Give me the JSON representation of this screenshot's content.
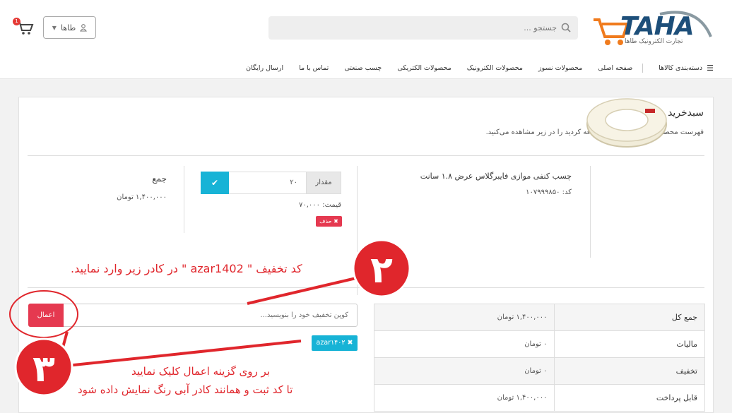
{
  "header": {
    "logo_text": "TAHA",
    "logo_subtitle": "تجارت الکترونیک طاها",
    "search_placeholder": "جستجو ...",
    "user_label": "طاها",
    "cart_count": "1"
  },
  "nav": {
    "categories_label": "دسته‌بندی کالاها",
    "items": [
      "صفحه اصلی",
      "محصولات نسوز",
      "محصولات الکترونیک",
      "محصولات الکتریکی",
      "چسب صنعتی",
      "تماس با ما",
      "ارسال رایگان"
    ]
  },
  "cart": {
    "title": "سبدخرید",
    "subtitle": "فهرست محصولاتی که به سبدخرید اضافه کردید را در زیر مشاهده می‌کنید.",
    "product": {
      "name": "چسب کنفی موازی فایبرگلاس عرض ۱.۸ سانت",
      "code": "کد: ۱۰۷۹۹۹۸۵۰",
      "qty_label": "مقدار",
      "qty_value": "۲۰",
      "price": "قیمت: ۷۰,۰۰۰",
      "delete_label": "✖ حذف",
      "sum_label": "جمع",
      "sum_value": "۱,۴۰۰,۰۰۰ تومان"
    },
    "coupon": {
      "placeholder": "کوپن تخفیف خود را بنویسید...",
      "apply_label": "اعمال",
      "applied_tag": "azar۱۴۰۲ ✖"
    },
    "totals": [
      {
        "label": "جمع کل",
        "value": "۱,۴۰۰,۰۰۰ تومان"
      },
      {
        "label": "مالیات",
        "value": "۰ تومان"
      },
      {
        "label": "تخفیف",
        "value": "۰ تومان"
      },
      {
        "label": "قابل پرداخت",
        "value": "۱,۴۰۰,۰۰۰ تومان"
      }
    ]
  },
  "annotations": {
    "step2_number": "۲",
    "step2_text": "کد تخفیف \" azar1402 \" در کادر زیر وارد نمایید.",
    "step3_number": "۳",
    "step3_line1": "بر روی گزینه اعمال کلیک نمایید",
    "step3_line2": "تا کد ثبت و همانند کادر آبی رنگ نمایش داده شود",
    "color": "#e0262c"
  }
}
